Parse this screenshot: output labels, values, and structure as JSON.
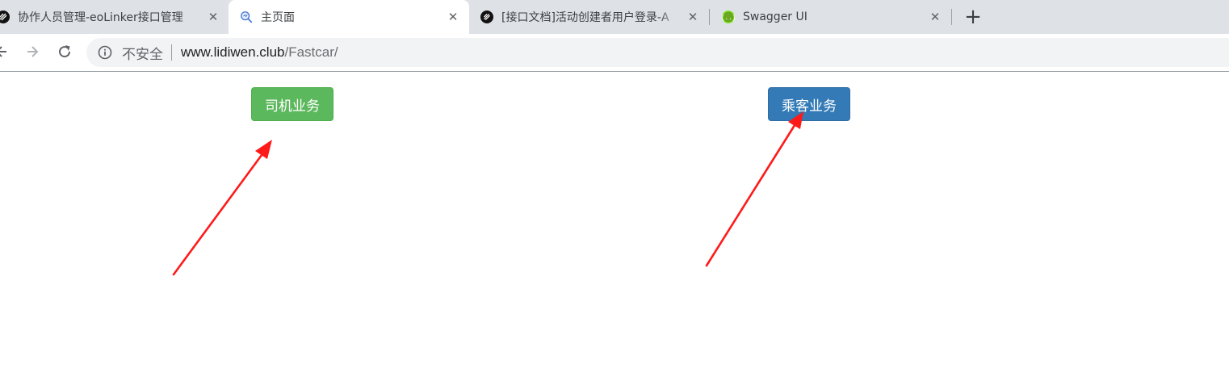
{
  "browser": {
    "tabs": [
      {
        "title": "协作人员管理-eoLinker接口管理",
        "favicon": "eolinker-icon",
        "active": false
      },
      {
        "title": "主页面",
        "favicon": "search-page-icon",
        "active": true
      },
      {
        "title": "[接口文档]活动创建者用户登录-A",
        "favicon": "eolinker-icon",
        "active": false
      },
      {
        "title": "Swagger UI",
        "favicon": "swagger-icon",
        "active": false
      }
    ],
    "new_tab_label": "+",
    "close_label": "✕"
  },
  "omnibox": {
    "security_label": "不安全",
    "url_host": "www.lidiwen.club",
    "url_path": "/Fastcar/"
  },
  "page": {
    "driver_button_label": "司机业务",
    "passenger_button_label": "乘客业务"
  },
  "colors": {
    "driver_button": "#5cb85c",
    "passenger_button": "#337ab7",
    "annotation_arrow": "#ff1a1a",
    "tabstrip": "#dee1e6"
  }
}
